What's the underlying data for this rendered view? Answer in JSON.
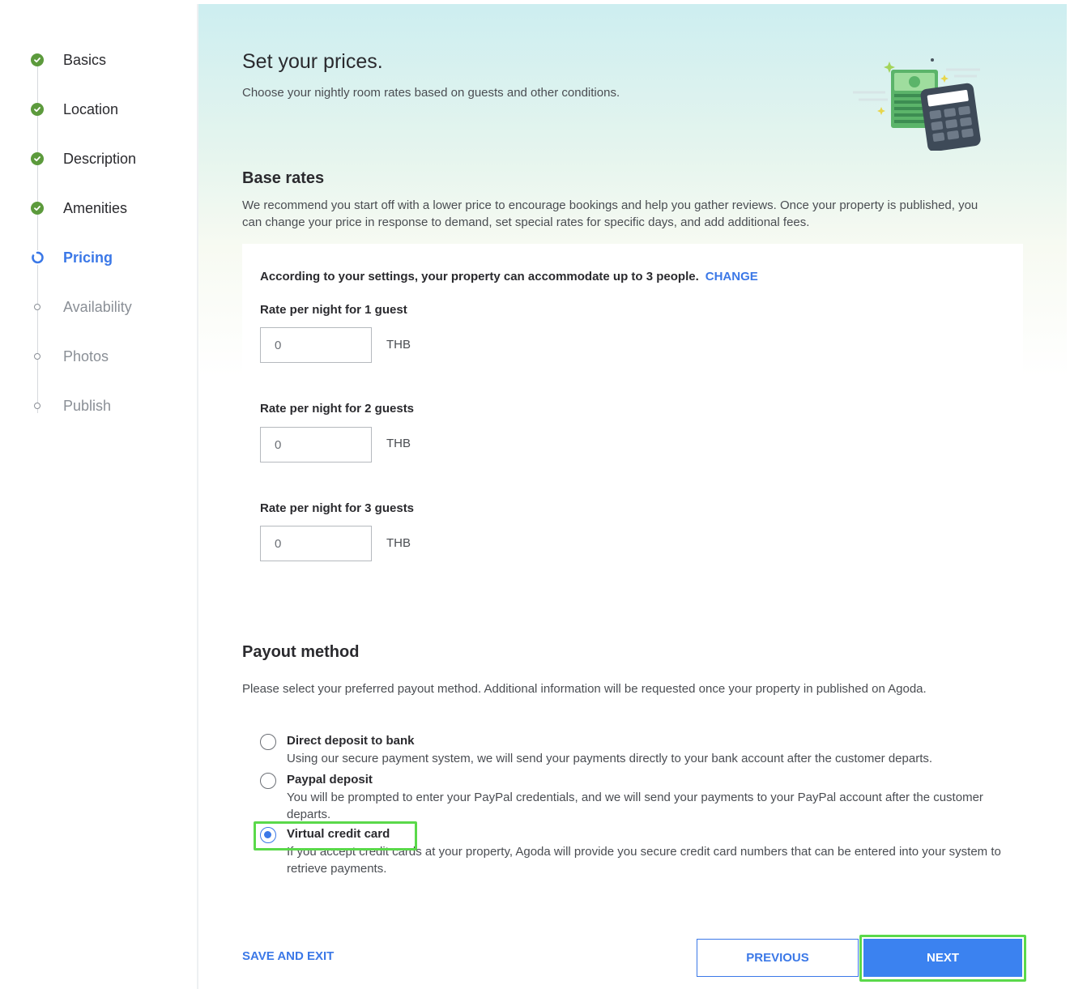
{
  "sidebar": {
    "steps": [
      {
        "label": "Basics",
        "state": "done"
      },
      {
        "label": "Location",
        "state": "done"
      },
      {
        "label": "Description",
        "state": "done"
      },
      {
        "label": "Amenities",
        "state": "done"
      },
      {
        "label": "Pricing",
        "state": "active"
      },
      {
        "label": "Availability",
        "state": "todo"
      },
      {
        "label": "Photos",
        "state": "todo"
      },
      {
        "label": "Publish",
        "state": "todo"
      }
    ]
  },
  "header": {
    "title": "Set your prices.",
    "subtitle": "Choose your nightly room rates based on guests and other conditions.",
    "illustration_icon": "calculator-money-icon"
  },
  "base_rates": {
    "title": "Base rates",
    "description": "We recommend you start off with a lower price to encourage bookings and help you gather reviews. Once your property is published, you can change your price in response to demand, set special rates for specific days, and add additional fees.",
    "capacity_text": "According to your settings, your property can accommodate up to 3 people.",
    "change_link": "CHANGE",
    "rates": [
      {
        "label": "Rate per night for 1 guest",
        "value": "0",
        "currency": "THB"
      },
      {
        "label": "Rate per night for 2 guests",
        "value": "0",
        "currency": "THB"
      },
      {
        "label": "Rate per night for 3 guests",
        "value": "0",
        "currency": "THB"
      }
    ]
  },
  "payout": {
    "title": "Payout method",
    "description": "Please select your preferred payout method. Additional information will be requested once your property in published on Agoda.",
    "options": [
      {
        "title": "Direct deposit to bank",
        "desc": "Using our secure payment system, we will send your payments directly to your bank account after the customer departs.",
        "selected": false
      },
      {
        "title": "Paypal deposit",
        "desc": "You will be prompted to enter your PayPal credentials, and we will send your payments to your PayPal account after the customer departs.",
        "selected": false
      },
      {
        "title": "Virtual credit card",
        "desc": "If you accept credit cards at your property, Agoda will provide you secure credit card numbers that can be entered into your system to retrieve payments.",
        "selected": true
      }
    ]
  },
  "footer": {
    "save_exit": "SAVE AND EXIT",
    "previous": "PREVIOUS",
    "next": "NEXT"
  },
  "colors": {
    "accent": "#3b78e7",
    "done": "#5c9a3c",
    "highlight": "#5ad94a"
  }
}
